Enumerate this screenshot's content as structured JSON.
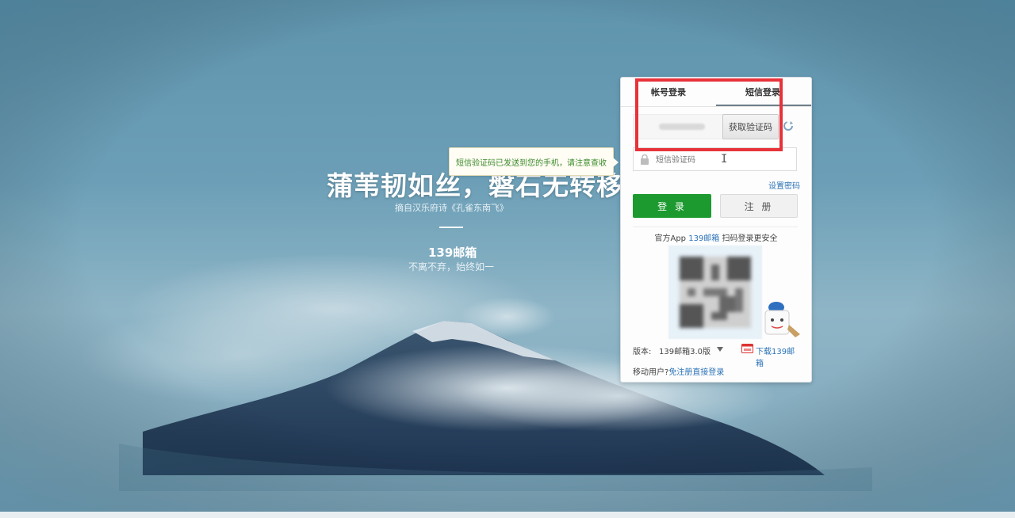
{
  "hero": {
    "title": "蒲苇韧如丝，磐石无转移",
    "source": "摘自汉乐府诗《孔雀东南飞》",
    "brand": "139邮箱",
    "slogan": "不离不弃，始终如一"
  },
  "tooltip": {
    "message": "短信验证码已发送到您的手机，请注意查收"
  },
  "login_panel": {
    "tabs": [
      {
        "label": "帐号登录"
      },
      {
        "label": "短信登录",
        "active": true
      }
    ],
    "get_code_button": "获取验证码",
    "code_placeholder": "短信验证码",
    "reset_password": "设置密码",
    "login_button": "登 录",
    "register_button": "注 册",
    "app_prefix": "官方App",
    "app_name": "139邮箱",
    "app_suffix": "扫码登录更安全",
    "version_label": "版本:",
    "version_value": "139邮箱3.0版",
    "download_label": "下载139邮箱",
    "mobile_user_prefix": "移动用户?",
    "mobile_user_link": "免注册直接登录"
  },
  "colors": {
    "login_green": "#1d9a2f",
    "link_blue": "#2b73b8",
    "highlight_red": "#e8323a",
    "tooltip_green": "#3a8a2a"
  },
  "icons": [
    "refresh-icon",
    "lock-icon",
    "qr-code",
    "mascot-icon",
    "dropdown-icon",
    "download-icon"
  ]
}
